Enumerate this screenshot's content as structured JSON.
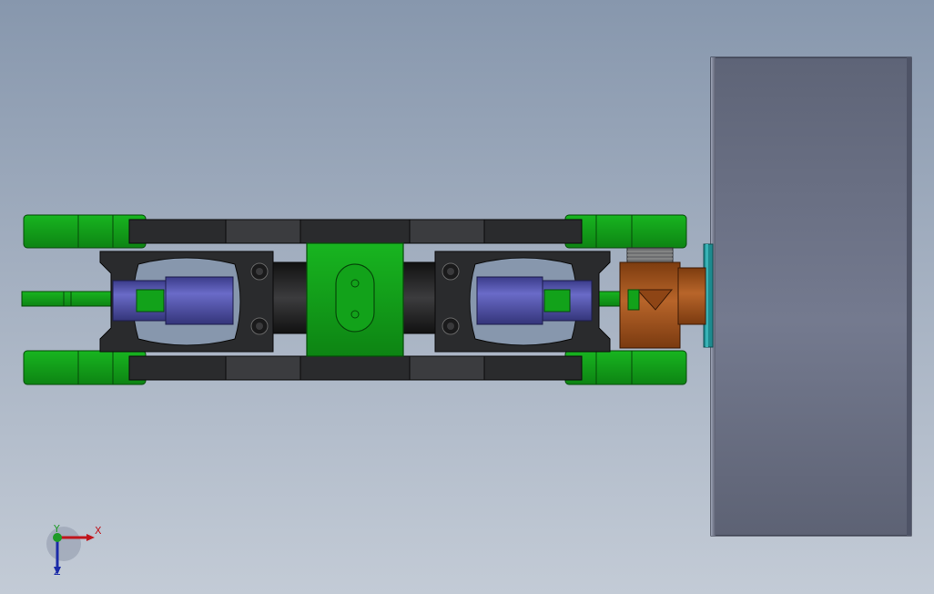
{
  "viewport": {
    "background_top": "#8797ad",
    "background_bottom": "#c3cbd6"
  },
  "model": {
    "part_colors": {
      "frame": "#2a2b2d",
      "frame_highlight": "#4a4b4e",
      "green_parts": "#12a21a",
      "green_dark": "#0b7310",
      "cylinder_blue": "#4e4fa8",
      "brass_fitting": "#a9571e",
      "teal_hub": "#1d8a8e",
      "wheel_gray": "#6b7186"
    }
  },
  "triad": {
    "x_label": "X",
    "y_label": "Y",
    "z_label": "Z",
    "x_color": "#c0141b",
    "y_color": "#1f9b28",
    "z_color": "#1a2aa8"
  }
}
